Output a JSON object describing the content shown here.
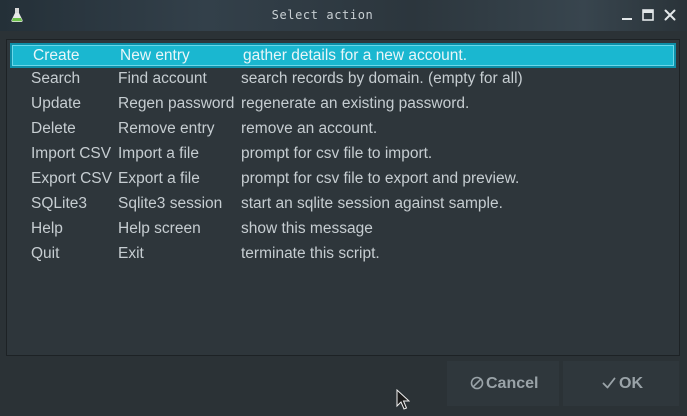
{
  "window": {
    "title": "Select action",
    "icons": {
      "app": "flask-icon",
      "minimize": "minimize-icon",
      "maximize": "maximize-icon",
      "close": "close-icon"
    }
  },
  "list": {
    "selected_index": 0,
    "rows": [
      {
        "command": "Create",
        "action": "New entry",
        "description": "gather details for a new account."
      },
      {
        "command": "Search",
        "action": "Find account",
        "description": "search records by domain. (empty for all)"
      },
      {
        "command": "Update",
        "action": "Regen password",
        "description": "regenerate an existing password."
      },
      {
        "command": "Delete",
        "action": "Remove entry",
        "description": "remove an account."
      },
      {
        "command": "Import CSV",
        "action": "Import a file",
        "description": "prompt for csv file to import."
      },
      {
        "command": "Export CSV",
        "action": "Export a file",
        "description": "prompt for csv file to export and preview."
      },
      {
        "command": "SQLite3",
        "action": "Sqlite3 session",
        "description": "start an sqlite session against sample."
      },
      {
        "command": "Help",
        "action": "Help screen",
        "description": "show this message"
      },
      {
        "command": "Quit",
        "action": "Exit",
        "description": "terminate this script."
      }
    ]
  },
  "buttons": {
    "cancel": {
      "label": "Cancel",
      "icon": "cancel-icon"
    },
    "ok": {
      "label": "OK",
      "icon": "checkmark-icon"
    }
  },
  "colors": {
    "selection": "#1ab7d0",
    "background": "#2b3236",
    "text": "#c6cdd1"
  }
}
